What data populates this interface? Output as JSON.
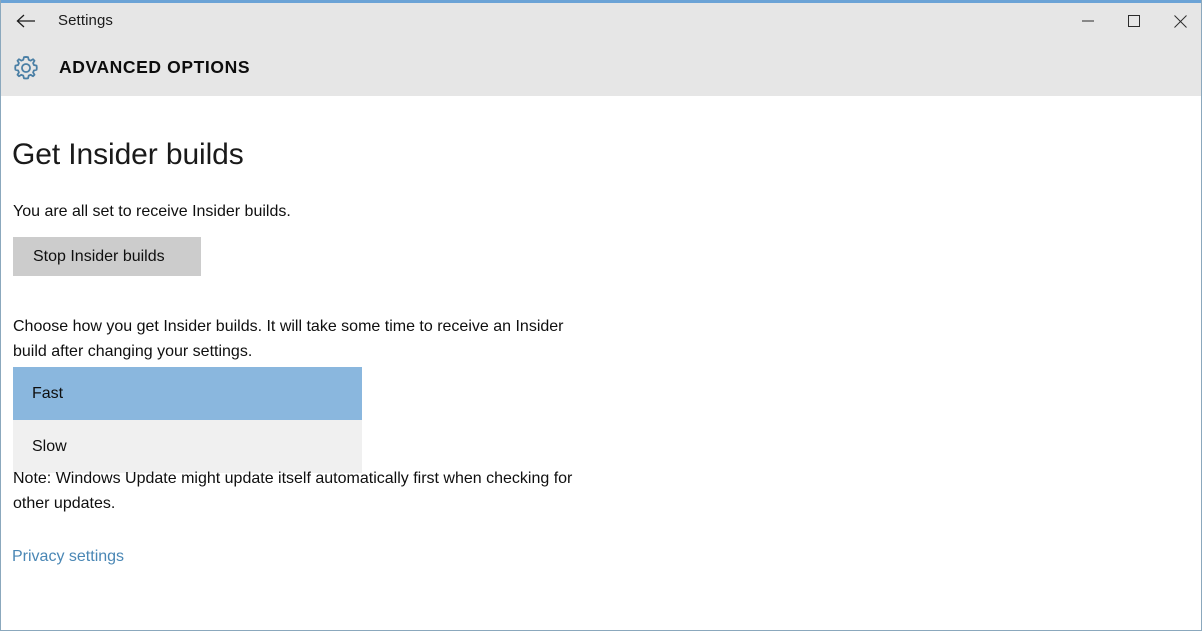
{
  "window": {
    "accent_color": "#6ba3d6",
    "border_color": "#8ba8bd",
    "titlebar": {
      "background": "#e6e6e6",
      "back_icon": "back-arrow-icon",
      "title": "Settings",
      "controls": [
        {
          "name": "minimize",
          "icon": "minimize-icon"
        },
        {
          "name": "maximize",
          "icon": "maximize-icon"
        },
        {
          "name": "close",
          "icon": "close-icon"
        }
      ]
    }
  },
  "header": {
    "icon": "gear-icon",
    "icon_color": "#4a7fa5",
    "title": "ADVANCED OPTIONS",
    "background": "#e6e6e6"
  },
  "main": {
    "page_title": "Get Insider builds",
    "status_text": "You are all set to receive Insider builds.",
    "stop_button_label": "Stop Insider builds",
    "stop_button_color": "#cccccc",
    "choose_text": "Choose how you get Insider builds. It will take some time to receive an Insider build after changing your settings.",
    "ring_dropdown": {
      "selected": "Fast",
      "highlight_color": "#8ab7de",
      "list_background": "#f0f0f0",
      "options": [
        {
          "label": "Fast",
          "selected": true
        },
        {
          "label": "Slow",
          "selected": false
        }
      ]
    },
    "note_text": "Note: Windows Update might update itself automatically first when checking for other updates.",
    "privacy_link": "Privacy settings",
    "privacy_link_color": "#4a87b5"
  }
}
